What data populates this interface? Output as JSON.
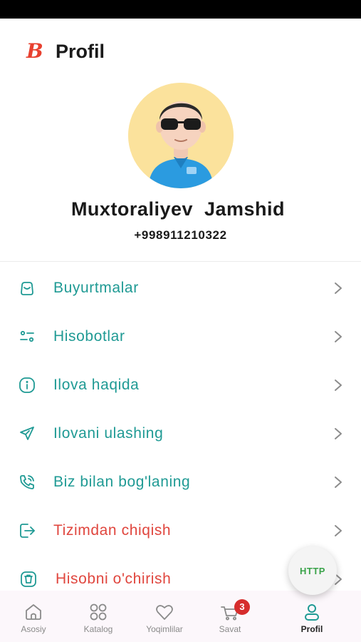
{
  "header": {
    "logo_letter": "B",
    "title": "Profil"
  },
  "profile": {
    "name": "Muxtoraliyev  Jamshid",
    "phone": "+998911210322"
  },
  "menu": {
    "items": [
      {
        "label": "Buyurtmalar",
        "icon": "bag-icon"
      },
      {
        "label": "Hisobotlar",
        "icon": "filter-sliders-icon"
      },
      {
        "label": "Ilova haqida",
        "icon": "info-icon"
      },
      {
        "label": "Ilovani ulashing",
        "icon": "send-icon"
      },
      {
        "label": "Biz bilan bog'laning",
        "icon": "phone-call-icon"
      },
      {
        "label": "Tizimdan chiqish",
        "icon": "logout-icon"
      },
      {
        "label": "Hisobni o'chirish",
        "icon": "trash-icon"
      }
    ]
  },
  "fab": {
    "label": "HTTP"
  },
  "tabbar": {
    "tabs": [
      {
        "label": "Asosiy",
        "icon": "home-icon"
      },
      {
        "label": "Katalog",
        "icon": "grid-icon"
      },
      {
        "label": "Yoqimlilar",
        "icon": "heart-icon"
      },
      {
        "label": "Savat",
        "icon": "cart-icon",
        "badge": "3"
      },
      {
        "label": "Profil",
        "icon": "user-icon",
        "active": true
      }
    ]
  },
  "colors": {
    "accent": "#1f9a94",
    "danger": "#e0463e",
    "brand": "#e8402f",
    "avatar_bg": "#fbe29c",
    "badge": "#d62d2d",
    "fab_text": "#3aa34a"
  }
}
